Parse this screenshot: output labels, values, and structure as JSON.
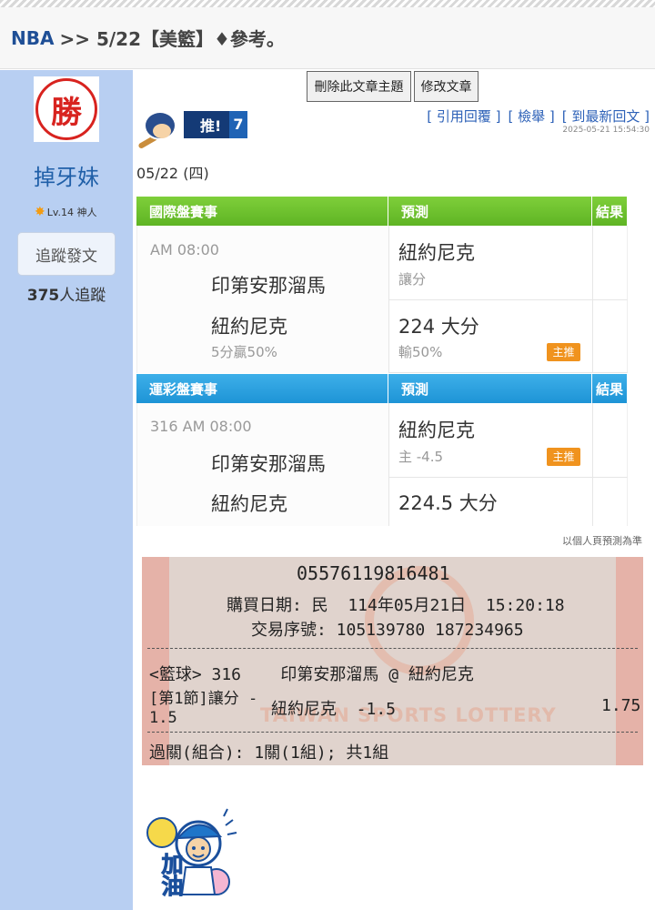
{
  "header": {
    "category": "NBA",
    "title": ">> 5/22【美籃】♦參考。"
  },
  "sidebar": {
    "avatar_glyph": "勝",
    "username": "掉牙妹",
    "level": "Lv.14 神人",
    "follow_label": "追蹤發文",
    "follower_count": "375",
    "follower_suffix": "人追蹤"
  },
  "toolbar": {
    "delete_label": "刪除此文章主題",
    "edit_label": "修改文章"
  },
  "post_links": {
    "quote": "[ 引用回覆 ]",
    "report": "[ 檢舉 ]",
    "latest": "[ 到最新回文 ]"
  },
  "timestamp": "2025-05-21 15:54:30",
  "push": {
    "label": "推!",
    "count": "7"
  },
  "post_date": "05/22 (四)",
  "international": {
    "header": {
      "game": "國際盤賽事",
      "prediction": "預測",
      "result": "結果"
    },
    "time": "AM 08:00",
    "away_team": "印第安那溜馬",
    "home_team": "紐約尼克",
    "home_note": "5分贏50%",
    "pred1": {
      "main": "紐約尼克",
      "sub": "讓分"
    },
    "pred2": {
      "main": "224 大分",
      "sub": "輸50%",
      "tag": "主推"
    }
  },
  "lottery": {
    "header": {
      "game": "運彩盤賽事",
      "prediction": "預測",
      "result": "結果"
    },
    "time": "316 AM 08:00",
    "away_team": "印第安那溜馬",
    "home_team": "紐約尼克",
    "pred1": {
      "main": "紐約尼克",
      "sub": "主 -4.5",
      "tag": "主推"
    },
    "pred2": {
      "main": "224.5 大分"
    }
  },
  "note": "以個人頁預測為準",
  "ticket": {
    "number": "05576119816481",
    "purchase_date": "購買日期: 民  114年05月21日  15:20:18",
    "serial": "交易序號: 105139780 187234965",
    "game_line": "<籃球> 316    印第安那溜馬 @ 紐約尼克",
    "bet_type_1": "[第1節]讓分 -",
    "bet_type_2": "1.5",
    "bet_pick": "紐約尼克  -1.5",
    "odds": "1.75",
    "parlay": "過關(組合): 1關(1組); 共1組",
    "watermark": "TAIWAN SPORTS LOTTERY"
  },
  "cheer_text": "加油"
}
